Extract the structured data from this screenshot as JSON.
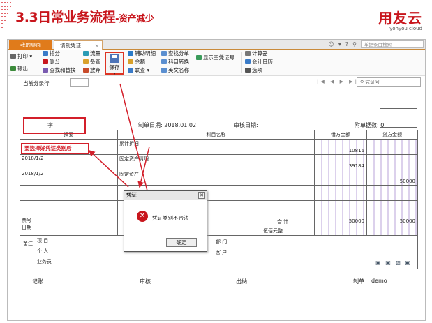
{
  "slide": {
    "title": "3.3日常业务流程",
    "subtitle": "-资产减少",
    "brand": "用友云",
    "brand_tag": "yonyou cloud"
  },
  "tabs": {
    "home": "我的桌面",
    "current": "填制凭证",
    "close": "×"
  },
  "top_right": {
    "search_placeholder": "单据条目搜索"
  },
  "toolbar": {
    "print": "打印",
    "export": "输出",
    "insert": "插分",
    "delete": "删分",
    "find_replace": "查找和替换",
    "flow": "流量",
    "note": "备查",
    "discard": "放弃",
    "save": "保存",
    "aux_detail": "辅助明细",
    "balance": "余额",
    "contact": "联查",
    "view_split": "查找分单",
    "subject_convert": "科目转换",
    "english_name": "英文名称",
    "show_empty": "显示空凭证号",
    "calculator": "计算器",
    "calendar": "会计日历",
    "options": "选项"
  },
  "filter": {
    "current_row": "当前分录行",
    "voucher_search": "凭证号"
  },
  "voucher": {
    "word_label": "字",
    "date_label": "制单日期:",
    "date_value": "2018.01.02",
    "review_label": "审核日期:",
    "attach_label": "附单据数:",
    "attach_value": "0",
    "col_summary": "摘要",
    "col_subject": "科目名称",
    "col_debit": "借方金额",
    "col_credit": "贷方金额",
    "rows": [
      {
        "summary": "",
        "subject": "累计折旧",
        "debit": "10816",
        "credit": ""
      },
      {
        "summary": "2018/1/2",
        "subject": "固定资产清理",
        "debit": "39184",
        "credit": ""
      },
      {
        "summary": "2018/1/2",
        "subject": "固定资产",
        "debit": "",
        "credit": "50000"
      }
    ],
    "ticket_no": "票号",
    "ticket_date": "日期",
    "total_label": "合 计",
    "total_debit": "50000",
    "total_credit": "50000",
    "total_words": "伍佰元整",
    "note_label": "备注",
    "project_label": "项 目",
    "person_label": "个 人",
    "salesman_label": "业务员",
    "dept_label": "部 门",
    "customer_label": "客 户",
    "bookkeep": "记账",
    "review": "审核",
    "cashier": "出纳",
    "maker_label": "制单",
    "maker_value": "demo"
  },
  "dialog": {
    "title": "凭证",
    "message": "凭证类别不合法",
    "ok": "确定"
  },
  "annotation": {
    "text": "要选择好凭证类别后"
  },
  "colors": {
    "accent_red": "#c8161d",
    "tab_orange": "#e07b1b"
  }
}
